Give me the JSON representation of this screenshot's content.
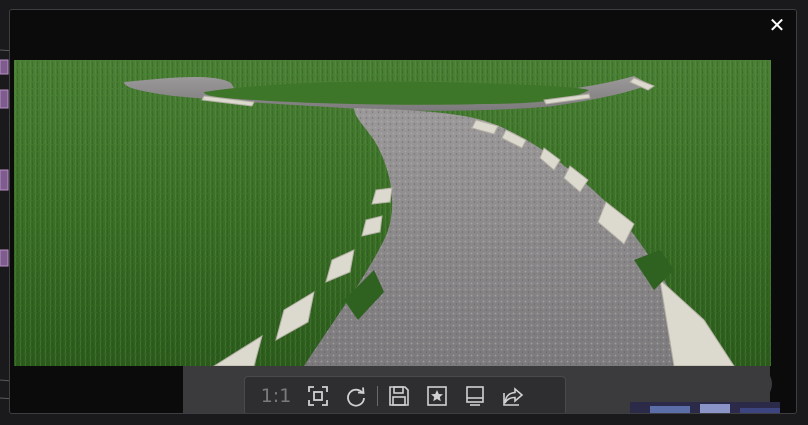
{
  "viewer": {
    "close_glyph": "✕",
    "close_icon": "close-icon"
  },
  "toolbar": {
    "zoom_label": "1:1",
    "buttons": [
      {
        "name": "fit-to-window-button",
        "icon": "fit-screen-icon"
      },
      {
        "name": "rotate-button",
        "icon": "rotate-icon"
      },
      {
        "name": "save-button",
        "icon": "save-icon"
      },
      {
        "name": "favorite-button",
        "icon": "bookmark-star-icon"
      },
      {
        "name": "display-button",
        "icon": "monitor-icon"
      },
      {
        "name": "share-button",
        "icon": "share-icon"
      }
    ]
  },
  "colors": {
    "grass": "#3f7a2a",
    "gravel": "#8d8b8d",
    "curb": "#d9d6cc",
    "frame": "#0b0b0c",
    "toolbar": "#2e2e31",
    "icon": "#d0d0d3"
  }
}
